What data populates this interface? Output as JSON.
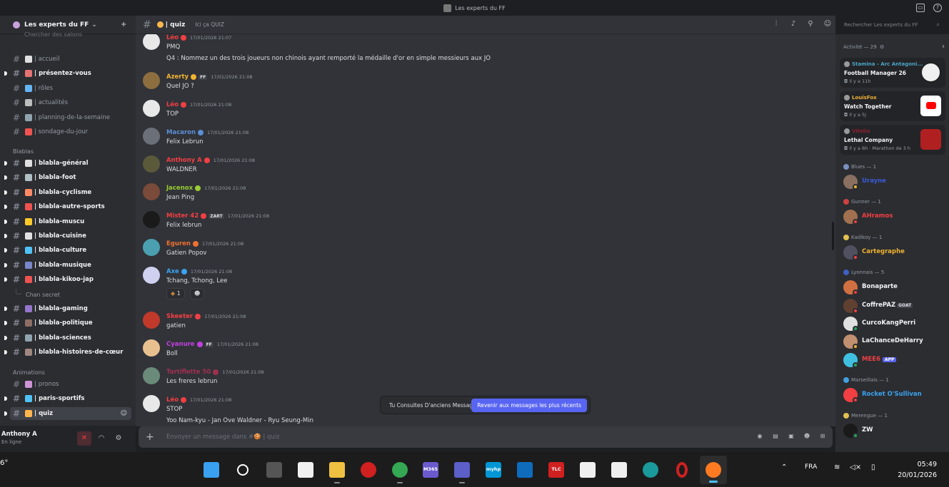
{
  "window": {
    "title": "Les experts du FF"
  },
  "server": {
    "name": "Les experts du FF",
    "search_hint": "Chercher des salons"
  },
  "channels": [
    {
      "label": "| accueil",
      "emoji_color": "#e0e0e0",
      "unread": false
    },
    {
      "label": "| présentez-vous",
      "emoji_color": "#e57373",
      "unread": true
    },
    {
      "label": "| rôles",
      "emoji_color": "#64b5f6",
      "unread": false
    },
    {
      "label": "| actualités",
      "emoji_color": "#bdbdbd",
      "unread": false
    },
    {
      "label": "| planning-de-la-semaine",
      "emoji_color": "#90a4ae",
      "unread": false
    },
    {
      "label": "| sondage-du-jour",
      "emoji_color": "#ef5350",
      "unread": false
    }
  ],
  "blablas": {
    "category": "Blablas",
    "items": [
      {
        "label": "| blabla-général",
        "emoji_color": "#e0e0e0"
      },
      {
        "label": "| blabla-foot",
        "emoji_color": "#b0bec5"
      },
      {
        "label": "| blabla-cyclisme",
        "emoji_color": "#ff8a65"
      },
      {
        "label": "| blabla-autre-sports",
        "emoji_color": "#ef5350"
      },
      {
        "label": "| blabla-muscu",
        "emoji_color": "#ffca28"
      },
      {
        "label": "| blabla-cuisine",
        "emoji_color": "#e0e0e0"
      },
      {
        "label": "| blabla-culture",
        "emoji_color": "#4fc3f7"
      },
      {
        "label": "| blabla-musique",
        "emoji_color": "#7986cb"
      },
      {
        "label": "| blabla-kikoo-jap",
        "emoji_color": "#ef5350"
      }
    ],
    "thread": "Chan secret",
    "items2": [
      {
        "label": "| blabla-gaming",
        "emoji_color": "#9575cd"
      },
      {
        "label": "| blabla-politique",
        "emoji_color": "#8d6e63"
      },
      {
        "label": "| blabla-sciences",
        "emoji_color": "#90a4ae"
      },
      {
        "label": "| blabla-histoires-de-cœur",
        "emoji_color": "#a1887f"
      }
    ]
  },
  "animations": {
    "category": "Animations",
    "items": [
      {
        "label": "| pronos",
        "emoji_color": "#ce93d8",
        "unread": false
      },
      {
        "label": "| paris-sportifs",
        "emoji_color": "#4fc3f7",
        "unread": true
      },
      {
        "label": "| quiz",
        "emoji_color": "#ffb74d",
        "unread": true
      }
    ]
  },
  "user": {
    "name": "Anthony A",
    "status": "En ligne"
  },
  "channel_header": {
    "name": "| quiz",
    "topic": "Ici ça QUIZ"
  },
  "search": {
    "placeholder": "Rechercher Les experts du FF"
  },
  "messages": [
    {
      "author": "Léo",
      "color": "#f23f43",
      "ts": "17/01/2026 21:07",
      "lines": [
        "PMQ",
        "Q4 : Nommez un des trois joueurs non chinois ayant remporté la médaille d'or en simple messieurs aux JO"
      ],
      "avatar": "#e8e8e8"
    },
    {
      "author": "Azerty",
      "color": "#f0b232",
      "badge": "FF",
      "ts": "17/01/2026 21:08",
      "lines": [
        "Quel JO ?"
      ],
      "avatar": "#8d6e3f"
    },
    {
      "author": "Léo",
      "color": "#f23f43",
      "ts": "17/01/2026 21:08",
      "lines": [
        "TOP"
      ],
      "avatar": "#e8e8e8"
    },
    {
      "author": "Macaron",
      "color": "#5b8fd6",
      "ts": "17/01/2026 21:08",
      "lines": [
        "Felix Lebrun"
      ],
      "avatar": "#6b6f78"
    },
    {
      "author": "Anthony A",
      "color": "#f23f43",
      "ts": "17/01/2026 21:08",
      "lines": [
        "WALDNER"
      ],
      "avatar": "#5a5a3a"
    },
    {
      "author": "Jacenox",
      "color": "#9acd32",
      "ts": "17/01/2026 21:08",
      "lines": [
        "Jean Ping"
      ],
      "avatar": "#7a4a3a"
    },
    {
      "author": "Mister 42",
      "color": "#f23f43",
      "badge": "ZART",
      "ts": "17/01/2026 21:08",
      "lines": [
        "Felix lebrun"
      ],
      "avatar": "#1a1a1a"
    },
    {
      "author": "Eguren",
      "color": "#f07030",
      "ts": "17/01/2026 21:08",
      "lines": [
        "Gatien Popov"
      ],
      "avatar": "#4aa0b0"
    },
    {
      "author": "Axe",
      "color": "#3ba3f0",
      "ts": "17/01/2026 21:08",
      "lines": [
        "Tchang, Tchong, Lee"
      ],
      "avatar": "#d0d0f0",
      "reaction": "1"
    },
    {
      "author": "Skeeter",
      "color": "#f23f43",
      "ts": "17/01/2026 21:08",
      "lines": [
        "gatien"
      ],
      "avatar": "#c0392b"
    },
    {
      "author": "Cyanure",
      "color": "#c040e0",
      "badge": "FF",
      "ts": "17/01/2026 21:08",
      "lines": [
        "Boll"
      ],
      "avatar": "#e8c090"
    },
    {
      "author": "Tartiflette 50",
      "color": "#a03050",
      "ts": "17/01/2026 21:08",
      "lines": [
        "Les freres lebrun"
      ],
      "avatar": "#6a8a7a"
    },
    {
      "author": "Léo",
      "color": "#f23f43",
      "ts": "17/01/2026 21:08",
      "lines": [
        "STOP",
        "Yoo Nam-kyu - Jan Ove Waldner - Ryu Seung-Min"
      ],
      "avatar": "#e8e8e8"
    }
  ],
  "jump_banner": {
    "text": "Tu Consultes D'anciens Messages",
    "button": "Revenir aux messages les plus récents"
  },
  "composer": {
    "placeholder": "Envoyer un message dans #🍪 | quiz"
  },
  "activity": {
    "title": "Activité — 29",
    "cards": [
      {
        "user": "Stamina - Arc Antagoni...",
        "color": "#4ba3c3",
        "game": "Football Manager 26",
        "time": "Il y a 11h",
        "thumb": "#f0f0f0"
      },
      {
        "user": "LouisFox",
        "color": "#f0b232",
        "game": "Watch Together",
        "time": "Il y a 5j",
        "thumb": "#ffffff"
      },
      {
        "user": "Vitalia",
        "color": "#8a2030",
        "game": "Lethal Company",
        "time": "Il y a 6h  ·  Marathon de 3 h",
        "thumb": "#b02020"
      }
    ]
  },
  "member_groups": [
    {
      "name": "Blues — 1",
      "icon": "#7a90c0",
      "members": [
        {
          "name": "Urayne",
          "color": "#3b5bd6",
          "status": "#f0b232",
          "avatar": "#8a7060"
        }
      ]
    },
    {
      "name": "Gunner — 1",
      "icon": "#d04040",
      "members": [
        {
          "name": "AHramos",
          "color": "#f23f43",
          "status": "#f23f43",
          "avatar": "#a07050"
        }
      ]
    },
    {
      "name": "Kadikoy — 1",
      "icon": "#e0c050",
      "members": [
        {
          "name": "Cartegraphe",
          "color": "#f0b232",
          "status": "#f23f43",
          "avatar": "#505060"
        }
      ]
    },
    {
      "name": "Lyonnais — 5",
      "icon": "#4060c0",
      "members": [
        {
          "name": "Bonaparte",
          "color": "#f2f3f5",
          "status": "#f23f43",
          "avatar": "#d07040"
        },
        {
          "name": "CoffrePAZ",
          "tag": "GOAT",
          "color": "#f2f3f5",
          "status": "#f23f43",
          "avatar": "#604030"
        },
        {
          "name": "CurcoKangPerri",
          "color": "#f2f3f5",
          "status": "#23a55a",
          "avatar": "#e0e0e0"
        },
        {
          "name": "LaChanceDeHarry",
          "color": "#f2f3f5",
          "status": "#f0b232",
          "avatar": "#c09070"
        },
        {
          "name": "MEE6",
          "app": "APP",
          "color": "#f23f43",
          "status": "#23a55a",
          "avatar": "#40c0e0"
        }
      ]
    },
    {
      "name": "Marseillais — 1",
      "icon": "#40a0e0",
      "members": [
        {
          "name": "Rocket O'Sullivan",
          "color": "#3ba3f0",
          "status": "#f23f43",
          "avatar": "#f23f43"
        }
      ]
    },
    {
      "name": "Merengue — 1",
      "icon": "#e0c050",
      "members": [
        {
          "name": "ZW",
          "color": "#f2f3f5",
          "status": "#23a55a",
          "avatar": "#1a1a1a"
        }
      ]
    }
  ],
  "taskbar": {
    "weather": "6°",
    "language": "FRA",
    "time": "05:49",
    "date": "20/01/2026",
    "apps": [
      {
        "name": "start",
        "label": "",
        "color": "#3aa0f0"
      },
      {
        "name": "search",
        "label": "",
        "color": "#1c1c1c"
      },
      {
        "name": "task-view",
        "label": "",
        "color": "#555"
      },
      {
        "name": "notepad",
        "label": "",
        "color": "#f0f0f0"
      },
      {
        "name": "file-explorer",
        "label": "",
        "color": "#f0c040"
      },
      {
        "name": "record",
        "label": "",
        "color": "#d02020"
      },
      {
        "name": "chrome",
        "label": "",
        "color": "#34a853"
      },
      {
        "name": "m365",
        "label": "M365",
        "color": "#6a5acd"
      },
      {
        "name": "teams",
        "label": "",
        "color": "#5b5fc7"
      },
      {
        "name": "myhp",
        "label": "myhp",
        "color": "#0096d6"
      },
      {
        "name": "outlook",
        "label": "",
        "color": "#0f6cbd"
      },
      {
        "name": "tlc",
        "label": "TLC",
        "color": "#d02020"
      },
      {
        "name": "document",
        "label": "",
        "color": "#f0f0f0"
      },
      {
        "name": "store",
        "label": "",
        "color": "#f0f0f0"
      },
      {
        "name": "edge",
        "label": "",
        "color": "#1a9a9a"
      },
      {
        "name": "opera",
        "label": "",
        "color": "#d02020"
      },
      {
        "name": "firefox",
        "label": "",
        "color": "#ff7a20"
      }
    ]
  }
}
